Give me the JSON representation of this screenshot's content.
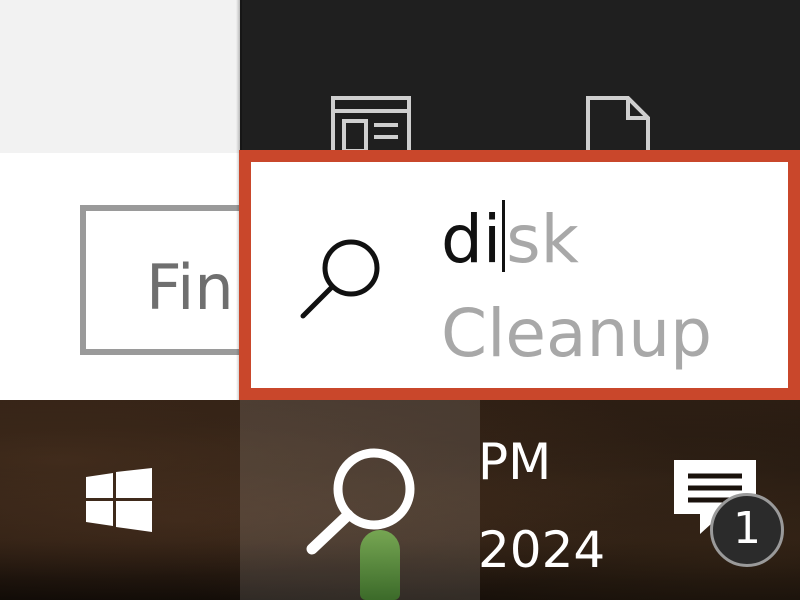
{
  "background_window": {
    "find_button_label": "Fin"
  },
  "search": {
    "typed_text": "di",
    "suggestion_inline": "sk",
    "suggestion_line2": "Cleanup"
  },
  "taskbar": {
    "clock_time": "PM",
    "clock_date": "2024",
    "notification_count": "1"
  },
  "colors": {
    "highlight_border": "#c9472b",
    "flyout_bg": "#1f1f1f"
  },
  "icons": [
    "apps-icon",
    "document-icon",
    "search-icon",
    "windows-start-icon",
    "action-center-icon"
  ]
}
